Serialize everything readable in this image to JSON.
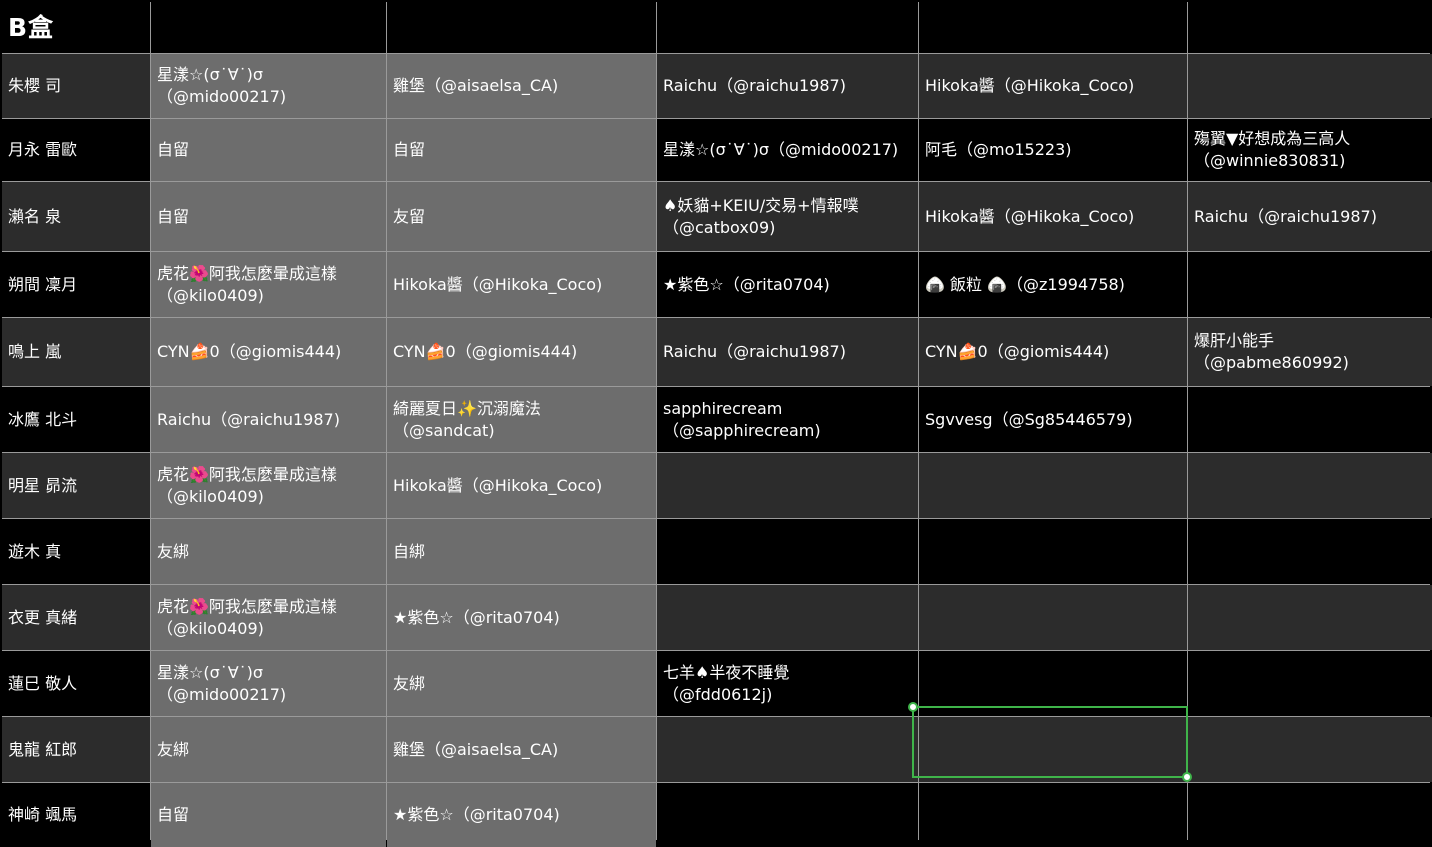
{
  "sheet": {
    "title": "B盒",
    "rows": [
      {
        "name": "朱櫻 司",
        "c1": "星漾☆(σ˙∀˙)σ\n（@mido00217)",
        "c2": "雞堡（@aisaelsa_CA)",
        "c3": "Raichu（@raichu1987)",
        "c4": "Hikoka醬（@Hikoka_Coco)",
        "c5": ""
      },
      {
        "name": "月永 雷歐",
        "c1": "自留",
        "c2": "自留",
        "c3": "星漾☆(σ˙∀˙)σ（@mido00217)",
        "c4": "阿毛（@mo15223)",
        "c5": "殤翼▼好想成為三高人\n（@winnie830831)"
      },
      {
        "name": "瀨名 泉",
        "c1": "自留",
        "c2": "友留",
        "c3": "♠妖貓+KEIU/交易+情報噗\n（@catbox09)",
        "c4": "Hikoka醬（@Hikoka_Coco)",
        "c5": "Raichu（@raichu1987)"
      },
      {
        "name": "朔間 凜月",
        "c1": "虎花🌺阿我怎麼暈成這樣\n（@kilo0409)",
        "c2": "Hikoka醬（@Hikoka_Coco)",
        "c3": "★紫色☆（@rita0704)",
        "c4": "🍙 飯粒 🍙（@z1994758)",
        "c5": ""
      },
      {
        "name": "鳴上 嵐",
        "c1": "CYN🍰0（@giomis444)",
        "c2": "CYN🍰0（@giomis444)",
        "c3": "Raichu（@raichu1987)",
        "c4": "CYN🍰0（@giomis444)",
        "c5": "爆肝小能手\n（@pabme860992)"
      },
      {
        "name": "冰鷹 北斗",
        "c1": "Raichu（@raichu1987)",
        "c2": "綺麗夏日✨沉溺魔法\n（@sandcat)",
        "c3": "sapphirecream\n（@sapphirecream)",
        "c4": "Sgvvesg（@Sg85446579)",
        "c5": ""
      },
      {
        "name": "明星 昴流",
        "c1": "虎花🌺阿我怎麼暈成這樣\n（@kilo0409)",
        "c2": "Hikoka醬（@Hikoka_Coco)",
        "c3": "",
        "c4": "",
        "c5": ""
      },
      {
        "name": "遊木 真",
        "c1": "友綁",
        "c2": "自綁",
        "c3": "",
        "c4": "",
        "c5": ""
      },
      {
        "name": "衣更 真緒",
        "c1": "虎花🌺阿我怎麼暈成這樣\n（@kilo0409)",
        "c2": "★紫色☆（@rita0704)",
        "c3": "",
        "c4": "",
        "c5": ""
      },
      {
        "name": "蓮巳 敬人",
        "c1": "星漾☆(σ˙∀˙)σ\n（@mido00217)",
        "c2": "友綁",
        "c3": "七羊♠半夜不睡覺\n（@fdd0612j)",
        "c4": "",
        "c5": ""
      },
      {
        "name": "鬼龍 紅郎",
        "c1": "友綁",
        "c2": "雞堡（@aisaelsa_CA)",
        "c3": "",
        "c4": "",
        "c5": ""
      },
      {
        "name": "神崎 颯馬",
        "c1": "自留",
        "c2": "★紫色☆（@rita0704)",
        "c3": "",
        "c4": "",
        "c5": ""
      }
    ]
  },
  "colors": {
    "gridline": "#9a9a9a",
    "selection": "#3fb44a",
    "gray_col": "#6d6d6d",
    "row_dark": "#000000",
    "row_mid": "#2c2c2c"
  }
}
